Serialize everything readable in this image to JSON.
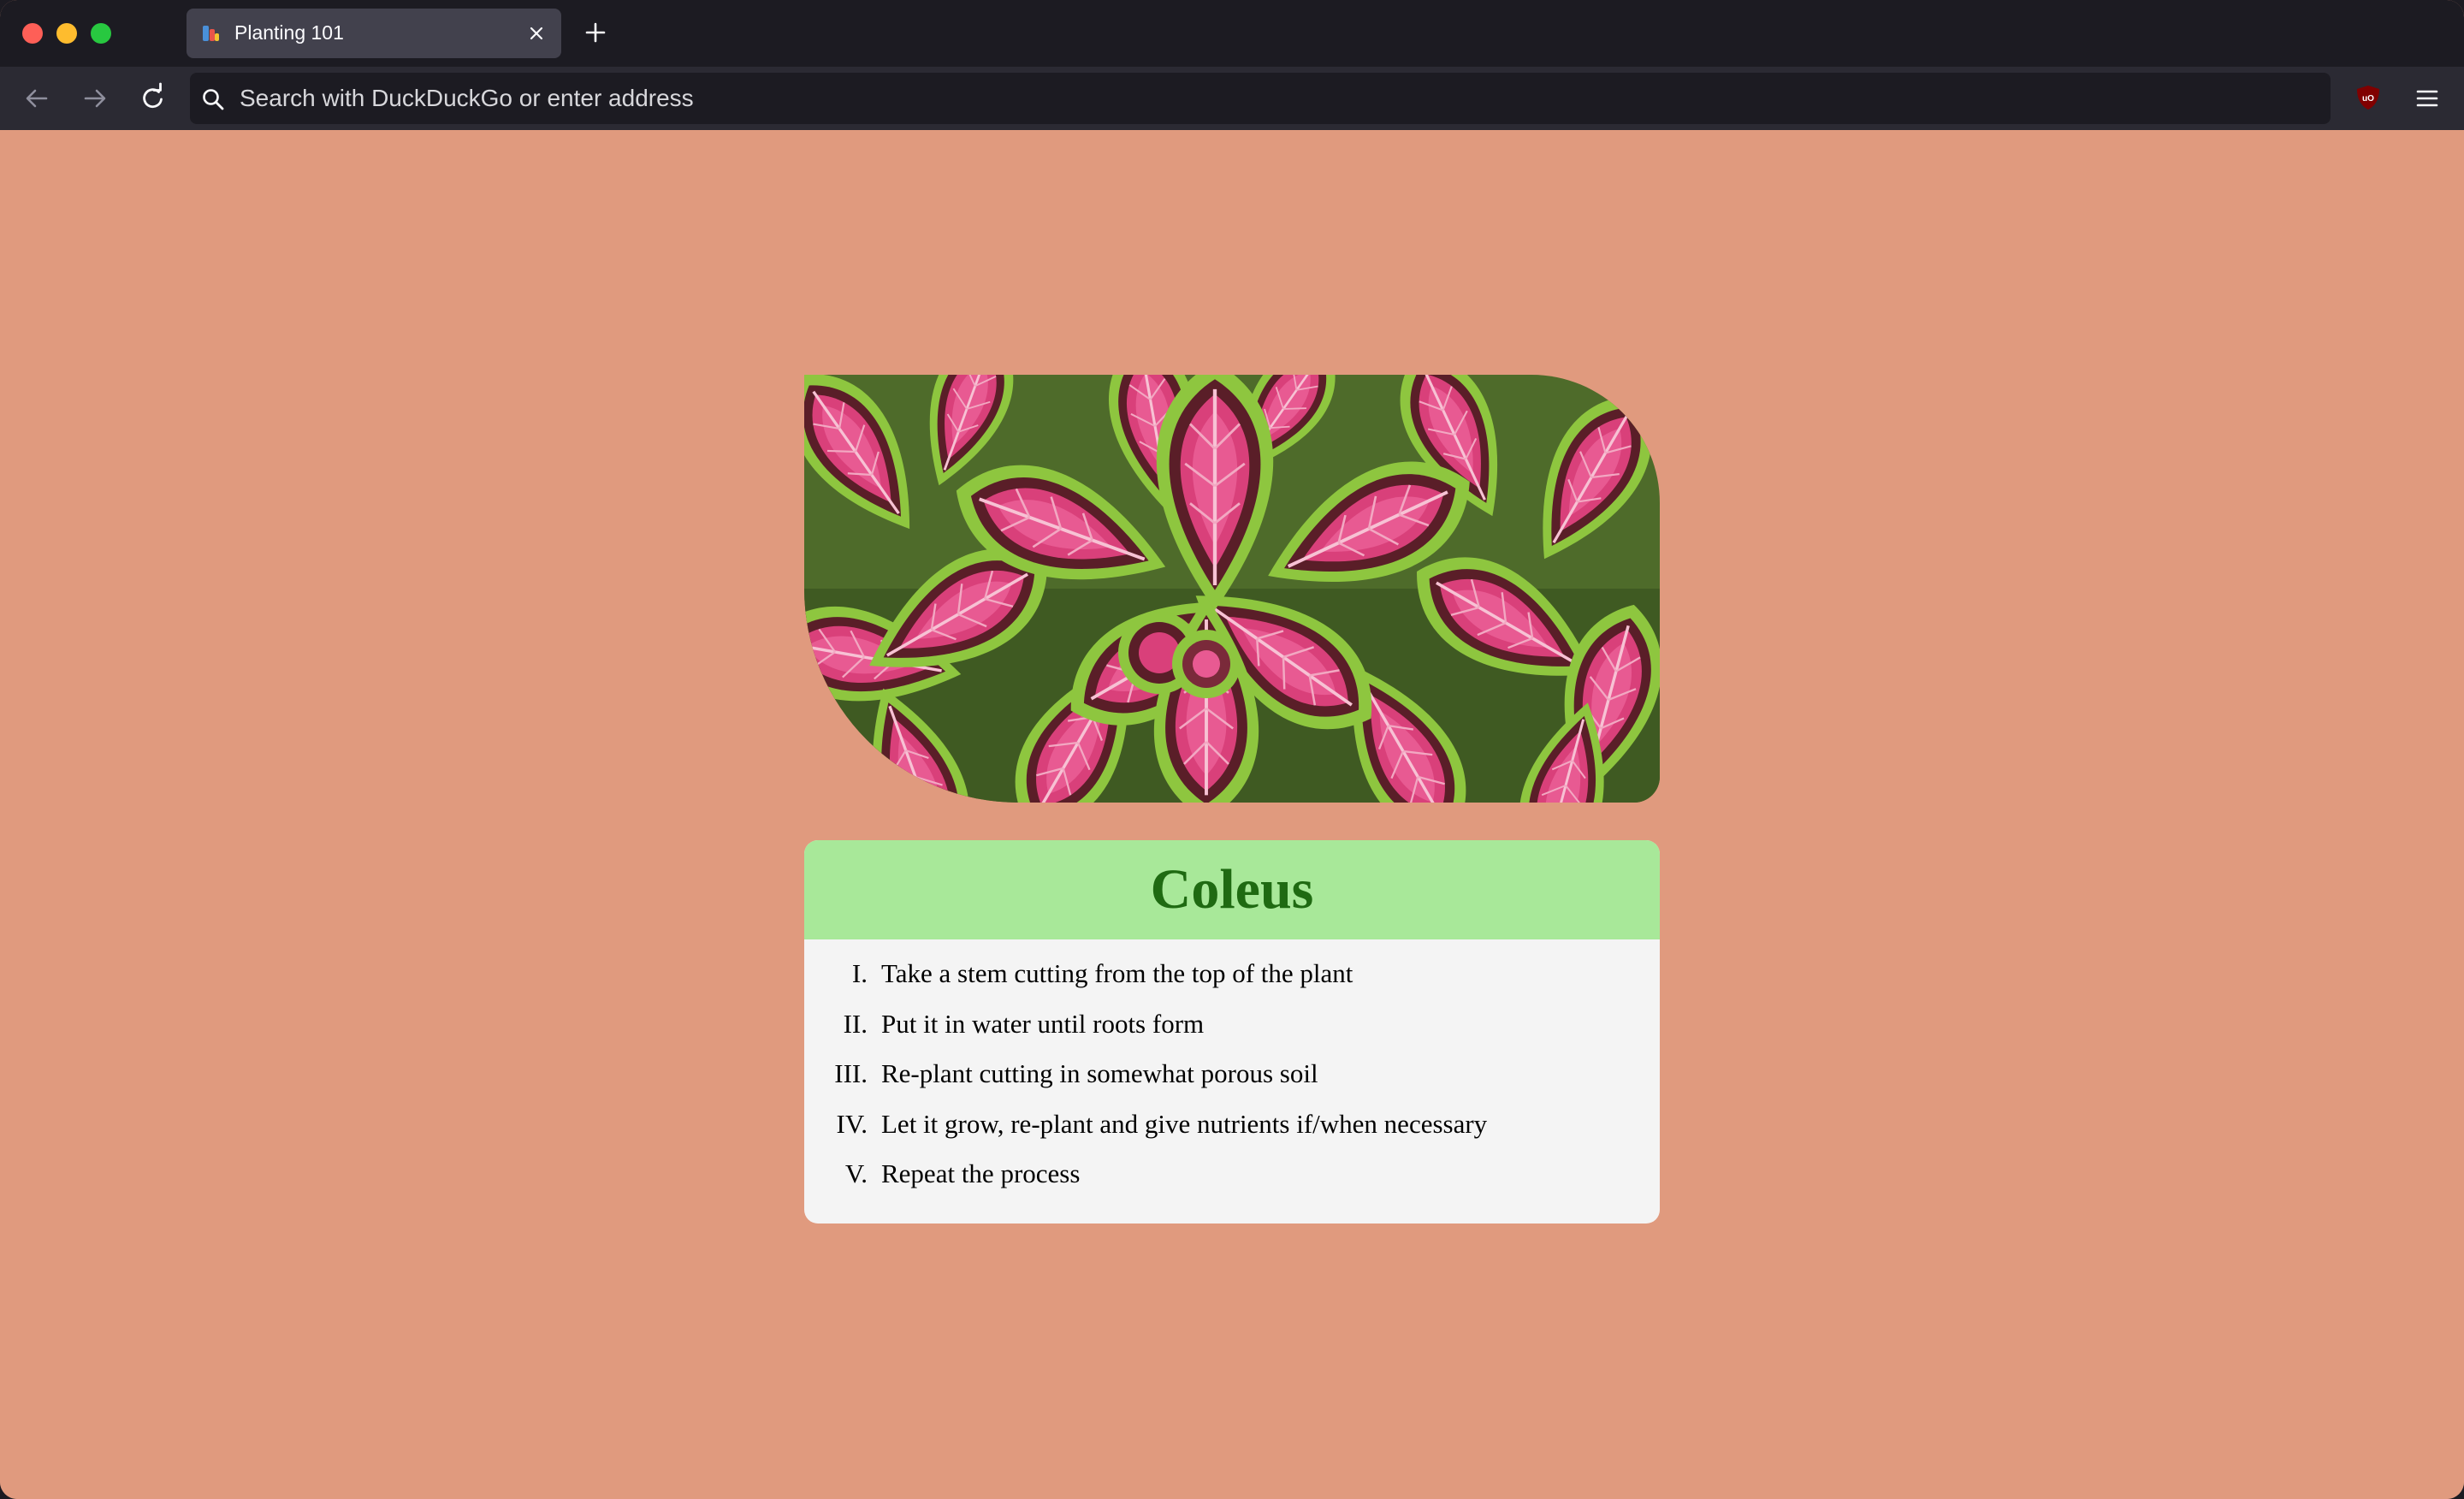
{
  "browser": {
    "tab": {
      "title": "Planting 101",
      "favicon": "planting-favicon-icon",
      "close_icon": "close-icon"
    },
    "newtab_icon": "plus-icon",
    "nav": {
      "back_icon": "arrow-left-icon",
      "forward_icon": "arrow-right-icon",
      "reload_icon": "reload-icon"
    },
    "urlbar": {
      "placeholder": "Search with DuckDuckGo or enter address",
      "value": "",
      "search_icon": "search-icon"
    },
    "extensions": [
      "ublock-origin-icon"
    ],
    "menu_icon": "hamburger-menu-icon"
  },
  "page": {
    "background_color": "#e09a7e",
    "image": {
      "subject": "coleus leaves",
      "icon": "coleus-photo"
    },
    "card": {
      "title": "Coleus",
      "header_color": "#a8e899",
      "title_color": "#1f6a12",
      "body_color": "#f4f4f4",
      "steps": [
        {
          "number": "I.",
          "text": "Take a stem cutting from the top of the plant"
        },
        {
          "number": "II.",
          "text": "Put it in water until roots form"
        },
        {
          "number": "III.",
          "text": "Re-plant cutting in somewhat porous soil"
        },
        {
          "number": "IV.",
          "text": "Let it grow, re-plant and give nutrients if/when necessary"
        },
        {
          "number": "V.",
          "text": "Repeat the process"
        }
      ]
    }
  }
}
